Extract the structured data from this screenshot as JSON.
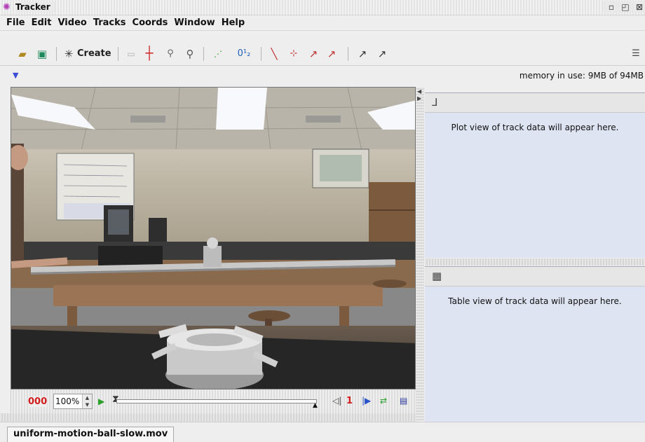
{
  "window": {
    "title": "Tracker",
    "app_icon": "tracker-logo-icon"
  },
  "menu": [
    "File",
    "Edit",
    "Video",
    "Tracks",
    "Coords",
    "Window",
    "Help"
  ],
  "toolbar": {
    "create_label": "Create",
    "icons": [
      "open-folder-icon",
      "save-icon",
      "create-star-icon",
      "calibration-stick-icon",
      "coordinate-axes-icon",
      "tape-measure-icon",
      "zoom-icon",
      "dots-trail-icon",
      "point-mass-icon",
      "line-profile-icon",
      "mass-point-icon",
      "velocity-vector-icon",
      "acceleration-vector-icon",
      "center-of-mass-icon",
      "multi-mass-icon",
      "notes-icon"
    ],
    "labels": {
      "points": "0¹₂"
    }
  },
  "status": {
    "memory": "memory in use: 9MB of 94MB"
  },
  "player": {
    "frame": "000",
    "zoom": "100%",
    "step": "1"
  },
  "plot_panel": {
    "message": "Plot view of track data will appear here."
  },
  "table_panel": {
    "message": "Table view of track data will appear here."
  },
  "tabs": [
    {
      "label": "uniform-motion-ball-slow.mov"
    }
  ]
}
